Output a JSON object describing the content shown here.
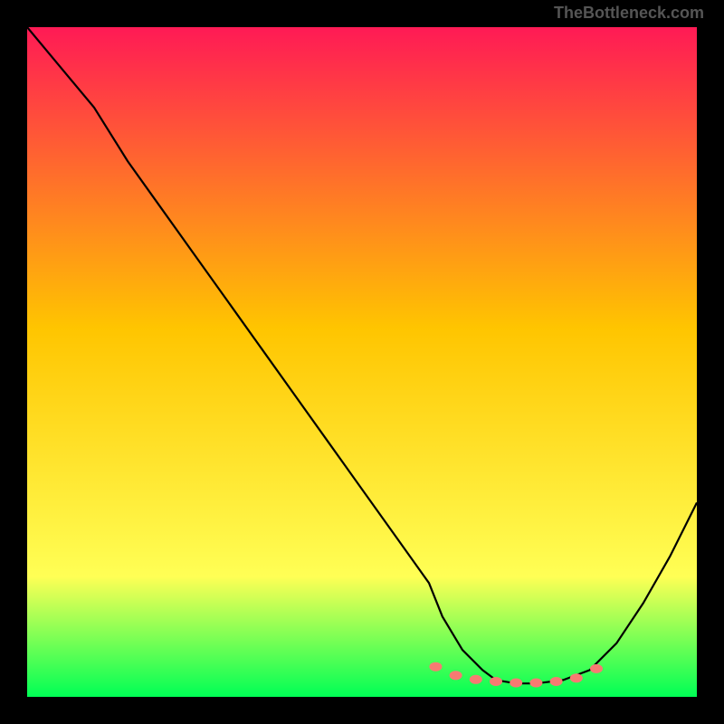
{
  "watermark": "TheBottleneck.com",
  "chart_data": {
    "type": "line",
    "title": "",
    "xlabel": "",
    "ylabel": "",
    "xlim": [
      0,
      100
    ],
    "ylim": [
      0,
      100
    ],
    "gradient_colors": {
      "top": "#ff1a55",
      "mid_warm": "#ffc500",
      "low_warm": "#ffff55",
      "bottom": "#00ff55"
    },
    "series": [
      {
        "name": "bottleneck-curve",
        "color": "#000000",
        "x": [
          0,
          5,
          10,
          15,
          20,
          25,
          30,
          35,
          40,
          45,
          50,
          55,
          60,
          62,
          65,
          68,
          70,
          73,
          76,
          80,
          84,
          88,
          92,
          96,
          100
        ],
        "values": [
          100,
          94,
          88,
          80,
          73,
          66,
          59,
          52,
          45,
          38,
          31,
          24,
          17,
          12,
          7,
          4,
          2.5,
          2,
          2,
          2.5,
          4,
          8,
          14,
          21,
          29
        ]
      }
    ],
    "markers": {
      "name": "optimal-range-dots",
      "color": "#f77a72",
      "x": [
        61,
        64,
        67,
        70,
        73,
        76,
        79,
        82,
        85
      ],
      "y": [
        4.5,
        3.2,
        2.6,
        2.3,
        2.1,
        2.1,
        2.3,
        2.8,
        4.2
      ]
    }
  }
}
